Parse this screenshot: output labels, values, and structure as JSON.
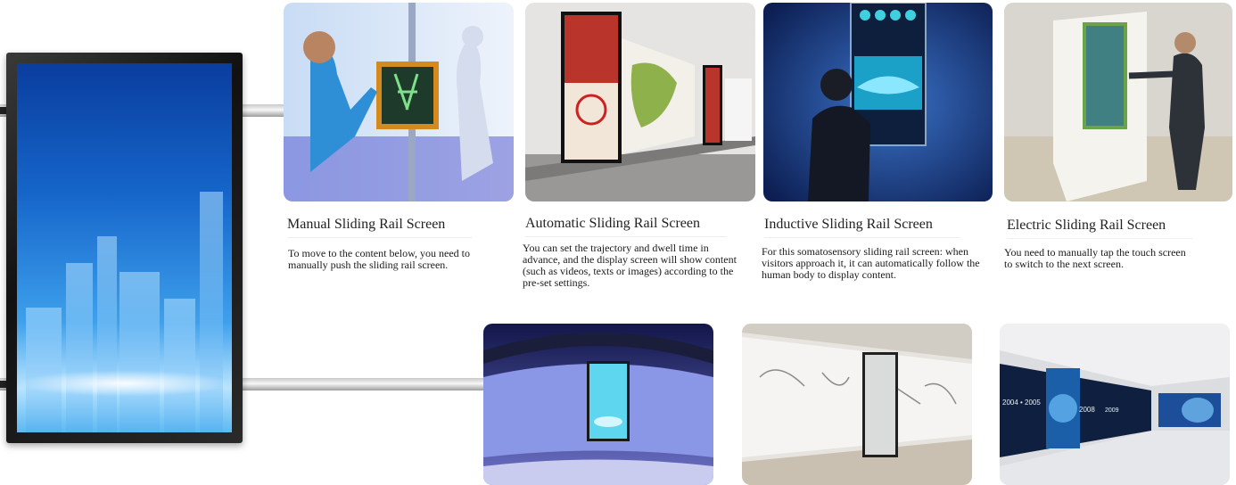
{
  "products": [
    {
      "title": "Manual Sliding Rail Screen",
      "description": "To move to the content below, you need to manually push the sliding rail screen."
    },
    {
      "title": "Automatic Sliding Rail Screen",
      "description": "You can set the trajectory and dwell time in advance, and the display screen will show content (such as videos, texts or images) according to the pre-set settings."
    },
    {
      "title": "Inductive Sliding Rail Screen",
      "description": "For this somatosensory sliding rail screen: when visitors approach it, it can automatically follow the human body to display content."
    },
    {
      "title": "Electric Sliding Rail Screen",
      "description": "You need to manually tap the touch screen to switch to the next screen."
    }
  ],
  "timeline_labels": [
    "2004 • 2005",
    "2008",
    "2009"
  ]
}
